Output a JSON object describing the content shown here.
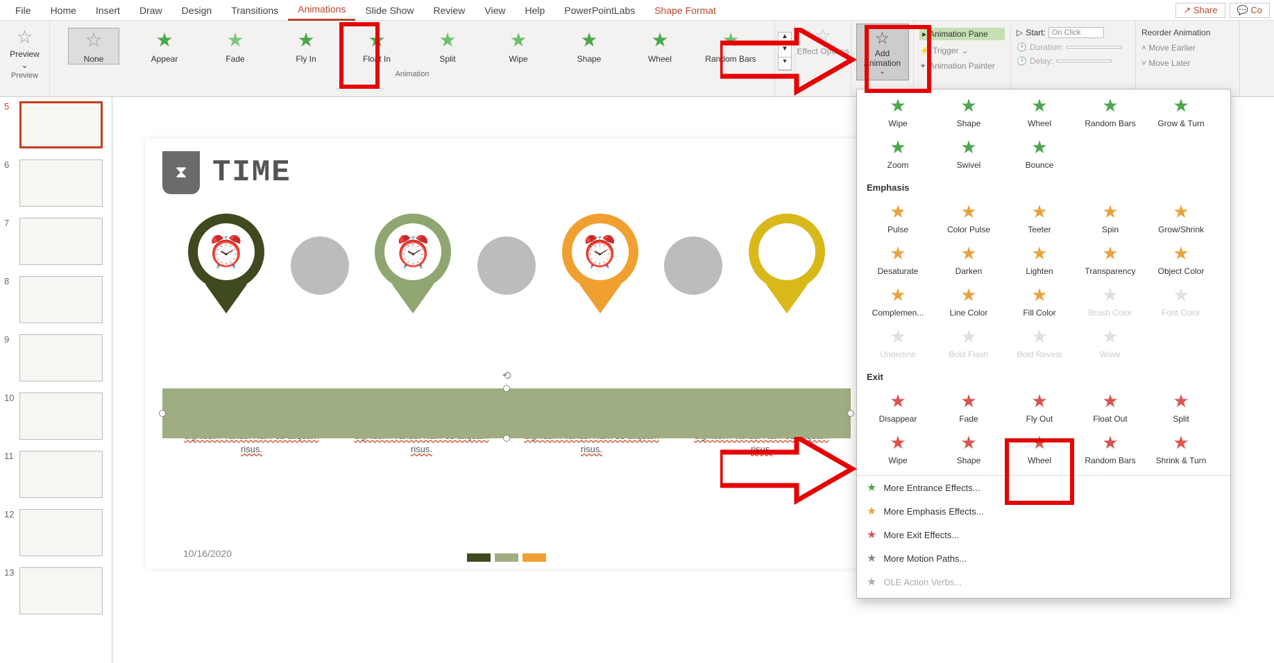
{
  "ribbon": {
    "tabs": [
      "File",
      "Home",
      "Insert",
      "Draw",
      "Design",
      "Transitions",
      "Animations",
      "Slide Show",
      "Review",
      "View",
      "Help",
      "PowerPointLabs",
      "Shape Format"
    ],
    "active_tab": "Animations",
    "share": "Share",
    "comments": "Co"
  },
  "preview_label": "Preview",
  "preview_btn": "Preview",
  "animation_group_label": "Animation",
  "gallery": [
    {
      "label": "None",
      "color": "#999"
    },
    {
      "label": "Appear",
      "color": "#4ca64c"
    },
    {
      "label": "Fade",
      "color": "#7ec97e"
    },
    {
      "label": "Fly In",
      "color": "#4ca64c"
    },
    {
      "label": "Float In",
      "color": "#4ca64c"
    },
    {
      "label": "Split",
      "color": "#6fbf6f"
    },
    {
      "label": "Wipe",
      "color": "#6fbf6f"
    },
    {
      "label": "Shape",
      "color": "#4ca64c"
    },
    {
      "label": "Wheel",
      "color": "#4ca64c"
    },
    {
      "label": "Random Bars",
      "color": "#6fbf6f"
    }
  ],
  "effect_options": "Effect Options",
  "add_animation": "Add Animation",
  "adv": {
    "pane": "Animation Pane",
    "trigger": "Trigger",
    "painter": "Animation Painter"
  },
  "timing": {
    "start_label": "Start:",
    "start_val": "On Click",
    "duration": "Duration:",
    "delay": "Delay:"
  },
  "reorder": {
    "title": "Reorder Animation",
    "earlier": "Move Earlier",
    "later": "Move Later"
  },
  "thumbs": [
    5,
    6,
    7,
    8,
    9,
    10,
    11,
    12,
    13
  ],
  "slide": {
    "title": "TIME",
    "lorem": "Lorem ipsum dolor sit amet, consectetur adipiscing elit. Nunc cursus eros nec lacus velit dignissim varius. Nam eu aliquam risus.",
    "date": "10/16/2020"
  },
  "dropdown": {
    "entrance_extra": [
      {
        "label": "Wipe"
      },
      {
        "label": "Shape"
      },
      {
        "label": "Wheel"
      },
      {
        "label": "Random Bars"
      },
      {
        "label": "Grow & Turn"
      },
      {
        "label": "Zoom"
      },
      {
        "label": "Swivel"
      },
      {
        "label": "Bounce"
      }
    ],
    "emphasis_title": "Emphasis",
    "emphasis": [
      {
        "label": "Pulse"
      },
      {
        "label": "Color Pulse"
      },
      {
        "label": "Teeter"
      },
      {
        "label": "Spin"
      },
      {
        "label": "Grow/Shrink"
      },
      {
        "label": "Desaturate"
      },
      {
        "label": "Darken"
      },
      {
        "label": "Lighten"
      },
      {
        "label": "Transparency"
      },
      {
        "label": "Object Color"
      },
      {
        "label": "Complemen..."
      },
      {
        "label": "Line Color"
      },
      {
        "label": "Fill Color"
      },
      {
        "label": "Brush Color",
        "d": true
      },
      {
        "label": "Font Color",
        "d": true
      },
      {
        "label": "Underline",
        "d": true
      },
      {
        "label": "Bold Flash",
        "d": true
      },
      {
        "label": "Bold Reveal",
        "d": true
      },
      {
        "label": "Wave",
        "d": true
      }
    ],
    "exit_title": "Exit",
    "exit": [
      {
        "label": "Disappear"
      },
      {
        "label": "Fade"
      },
      {
        "label": "Fly Out"
      },
      {
        "label": "Float Out"
      },
      {
        "label": "Split"
      },
      {
        "label": "Wipe"
      },
      {
        "label": "Shape"
      },
      {
        "label": "Wheel"
      },
      {
        "label": "Random Bars"
      },
      {
        "label": "Shrink & Turn"
      }
    ],
    "links": [
      {
        "label": "More Entrance Effects...",
        "color": "#4ca64c"
      },
      {
        "label": "More Emphasis Effects...",
        "color": "#e8a33d"
      },
      {
        "label": "More Exit Effects...",
        "color": "#d9534f"
      },
      {
        "label": "More Motion Paths...",
        "color": "#888"
      },
      {
        "label": "OLE Action Verbs...",
        "color": "#aaa",
        "d": true
      }
    ]
  }
}
